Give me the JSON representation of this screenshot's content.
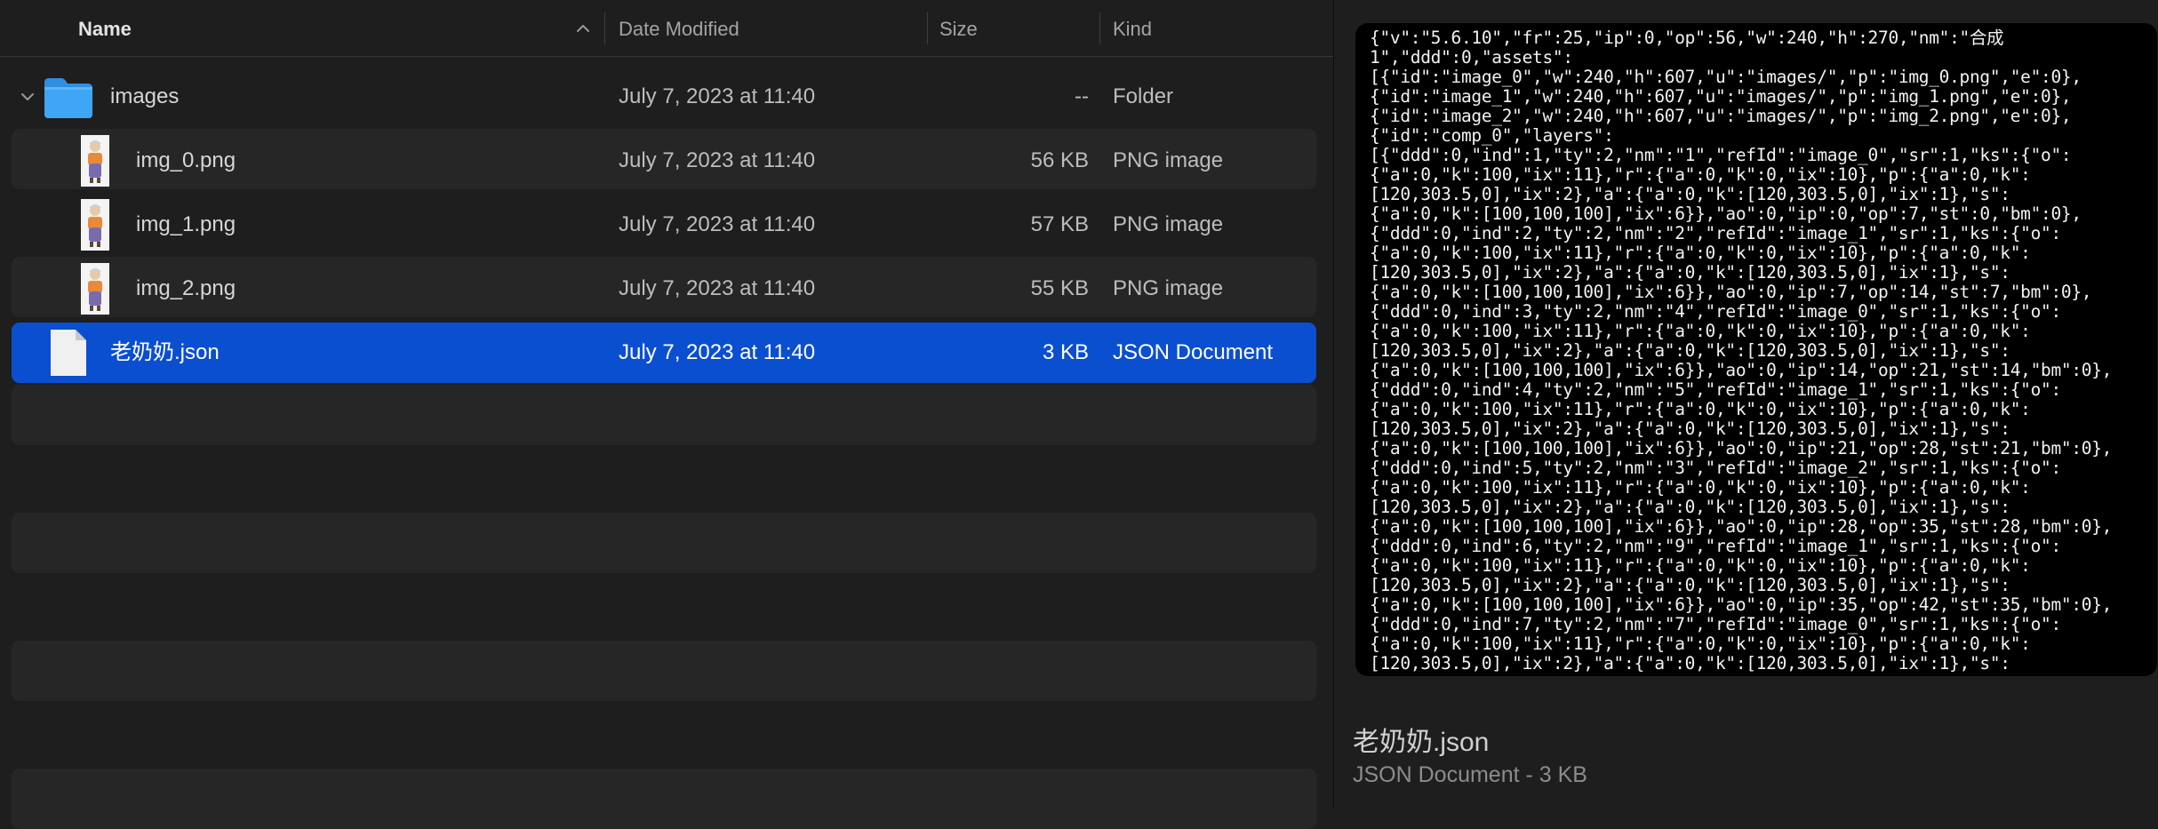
{
  "columns": {
    "name": "Name",
    "date": "Date Modified",
    "size": "Size",
    "kind": "Kind"
  },
  "files": [
    {
      "name": "images",
      "date": "July 7, 2023 at 11:40",
      "size": "--",
      "kind": "Folder",
      "icon": "folder-icon",
      "selected": false
    },
    {
      "name": "img_0.png",
      "date": "July 7, 2023 at 11:40",
      "size": "56 KB",
      "kind": "PNG image",
      "icon": "png-thumbnail-icon",
      "selected": false
    },
    {
      "name": "img_1.png",
      "date": "July 7, 2023 at 11:40",
      "size": "57 KB",
      "kind": "PNG image",
      "icon": "png-thumbnail-icon",
      "selected": false
    },
    {
      "name": "img_2.png",
      "date": "July 7, 2023 at 11:40",
      "size": "55 KB",
      "kind": "PNG image",
      "icon": "png-thumbnail-icon",
      "selected": false
    },
    {
      "name": "老奶奶.json",
      "date": "July 7, 2023 at 11:40",
      "size": "3 KB",
      "kind": "JSON Document",
      "icon": "json-document-icon",
      "selected": true
    }
  ],
  "preview": {
    "content_lines": [
      "{\"v\":\"5.6.10\",\"fr\":25,\"ip\":0,\"op\":56,\"w\":240,\"h\":270,\"nm\":\"合成",
      "1\",\"ddd\":0,\"assets\":",
      "[{\"id\":\"image_0\",\"w\":240,\"h\":607,\"u\":\"images/\",\"p\":\"img_0.png\",\"e\":0},",
      "{\"id\":\"image_1\",\"w\":240,\"h\":607,\"u\":\"images/\",\"p\":\"img_1.png\",\"e\":0},",
      "{\"id\":\"image_2\",\"w\":240,\"h\":607,\"u\":\"images/\",\"p\":\"img_2.png\",\"e\":0},",
      "{\"id\":\"comp_0\",\"layers\":",
      "[{\"ddd\":0,\"ind\":1,\"ty\":2,\"nm\":\"1\",\"refId\":\"image_0\",\"sr\":1,\"ks\":{\"o\":",
      "{\"a\":0,\"k\":100,\"ix\":11},\"r\":{\"a\":0,\"k\":0,\"ix\":10},\"p\":{\"a\":0,\"k\":",
      "[120,303.5,0],\"ix\":2},\"a\":{\"a\":0,\"k\":[120,303.5,0],\"ix\":1},\"s\":",
      "{\"a\":0,\"k\":[100,100,100],\"ix\":6}},\"ao\":0,\"ip\":0,\"op\":7,\"st\":0,\"bm\":0},",
      "{\"ddd\":0,\"ind\":2,\"ty\":2,\"nm\":\"2\",\"refId\":\"image_1\",\"sr\":1,\"ks\":{\"o\":",
      "{\"a\":0,\"k\":100,\"ix\":11},\"r\":{\"a\":0,\"k\":0,\"ix\":10},\"p\":{\"a\":0,\"k\":",
      "[120,303.5,0],\"ix\":2},\"a\":{\"a\":0,\"k\":[120,303.5,0],\"ix\":1},\"s\":",
      "{\"a\":0,\"k\":[100,100,100],\"ix\":6}},\"ao\":0,\"ip\":7,\"op\":14,\"st\":7,\"bm\":0},",
      "{\"ddd\":0,\"ind\":3,\"ty\":2,\"nm\":\"4\",\"refId\":\"image_0\",\"sr\":1,\"ks\":{\"o\":",
      "{\"a\":0,\"k\":100,\"ix\":11},\"r\":{\"a\":0,\"k\":0,\"ix\":10},\"p\":{\"a\":0,\"k\":",
      "[120,303.5,0],\"ix\":2},\"a\":{\"a\":0,\"k\":[120,303.5,0],\"ix\":1},\"s\":",
      "{\"a\":0,\"k\":[100,100,100],\"ix\":6}},\"ao\":0,\"ip\":14,\"op\":21,\"st\":14,\"bm\":0},",
      "{\"ddd\":0,\"ind\":4,\"ty\":2,\"nm\":\"5\",\"refId\":\"image_1\",\"sr\":1,\"ks\":{\"o\":",
      "{\"a\":0,\"k\":100,\"ix\":11},\"r\":{\"a\":0,\"k\":0,\"ix\":10},\"p\":{\"a\":0,\"k\":",
      "[120,303.5,0],\"ix\":2},\"a\":{\"a\":0,\"k\":[120,303.5,0],\"ix\":1},\"s\":",
      "{\"a\":0,\"k\":[100,100,100],\"ix\":6}},\"ao\":0,\"ip\":21,\"op\":28,\"st\":21,\"bm\":0},",
      "{\"ddd\":0,\"ind\":5,\"ty\":2,\"nm\":\"3\",\"refId\":\"image_2\",\"sr\":1,\"ks\":{\"o\":",
      "{\"a\":0,\"k\":100,\"ix\":11},\"r\":{\"a\":0,\"k\":0,\"ix\":10},\"p\":{\"a\":0,\"k\":",
      "[120,303.5,0],\"ix\":2},\"a\":{\"a\":0,\"k\":[120,303.5,0],\"ix\":1},\"s\":",
      "{\"a\":0,\"k\":[100,100,100],\"ix\":6}},\"ao\":0,\"ip\":28,\"op\":35,\"st\":28,\"bm\":0},",
      "{\"ddd\":0,\"ind\":6,\"ty\":2,\"nm\":\"9\",\"refId\":\"image_1\",\"sr\":1,\"ks\":{\"o\":",
      "{\"a\":0,\"k\":100,\"ix\":11},\"r\":{\"a\":0,\"k\":0,\"ix\":10},\"p\":{\"a\":0,\"k\":",
      "[120,303.5,0],\"ix\":2},\"a\":{\"a\":0,\"k\":[120,303.5,0],\"ix\":1},\"s\":",
      "{\"a\":0,\"k\":[100,100,100],\"ix\":6}},\"ao\":0,\"ip\":35,\"op\":42,\"st\":35,\"bm\":0},",
      "{\"ddd\":0,\"ind\":7,\"ty\":2,\"nm\":\"7\",\"refId\":\"image_0\",\"sr\":1,\"ks\":{\"o\":",
      "{\"a\":0,\"k\":100,\"ix\":11},\"r\":{\"a\":0,\"k\":0,\"ix\":10},\"p\":{\"a\":0,\"k\":",
      "[120,303.5,0],\"ix\":2},\"a\":{\"a\":0,\"k\":[120,303.5,0],\"ix\":1},\"s\":"
    ],
    "title": "老奶奶.json",
    "subtitle": "JSON Document - 3 KB"
  },
  "colors": {
    "selection": "#0b4fd1",
    "folder_blue": "#3ea6f4",
    "background": "#1e1e1e",
    "stripe": "#262626"
  }
}
